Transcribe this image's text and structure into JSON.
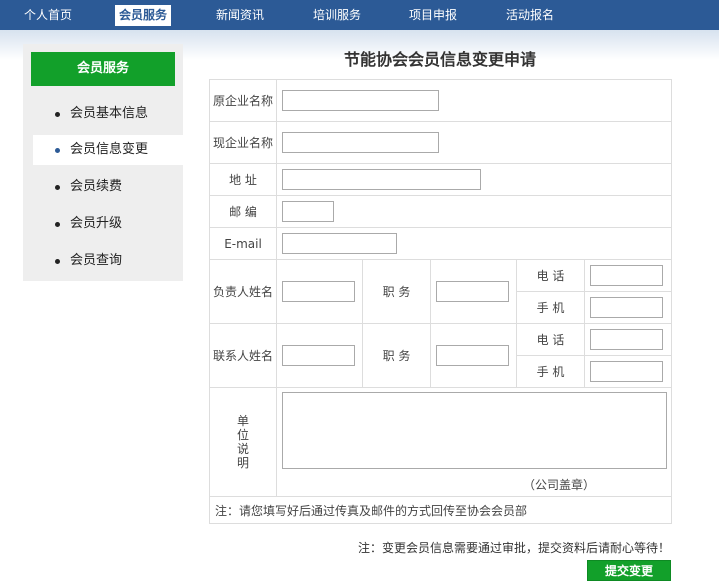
{
  "nav": {
    "items": [
      "个人首页",
      "会员服务",
      "新闻资讯",
      "培训服务",
      "项目申报",
      "活动报名"
    ],
    "active": "会员服务"
  },
  "sidebar": {
    "title": "会员服务",
    "items": [
      "会员基本信息",
      "会员信息变更",
      "会员续费",
      "会员升级",
      "会员查询"
    ],
    "active": "会员信息变更"
  },
  "form": {
    "title": "节能协会会员信息变更申请",
    "labels": {
      "old_name": "原企业名称",
      "new_name": "现企业名称",
      "address": "地 址",
      "postcode": "邮 编",
      "email": "E-mail",
      "principal": "负责人姓名",
      "contact": "联系人姓名",
      "position": "职 务",
      "phone": "电 话",
      "mobile": "手 机",
      "description": "单位说明"
    },
    "seal_note": "（公司盖章）",
    "note": "注：请您填写好后通过传真及邮件的方式回传至协会会员部"
  },
  "bottom_note": "注：变更会员信息需要通过审批，提交资料后请耐心等待！",
  "submit_label": "提交变更",
  "colors": {
    "nav_bg": "#2c5a96",
    "accent_green": "#12a02a",
    "sidebar_bg": "#eeeeee",
    "border": "#dddddd"
  }
}
